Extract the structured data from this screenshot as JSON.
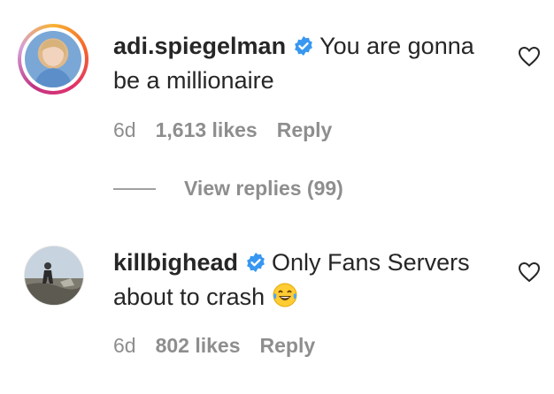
{
  "comments": [
    {
      "username": "adi.spiegelman",
      "verified": true,
      "text": "You are gonna be a millionaire",
      "time": "6d",
      "likes": "1,613 likes",
      "reply_label": "Reply",
      "view_replies": "View replies (99)",
      "avatar_icon": "profile-photo-with-story-ring"
    },
    {
      "username": "killbighead",
      "verified": true,
      "text": "Only Fans Servers about to crash",
      "emoji": "😂",
      "time": "6d",
      "likes": "802 likes",
      "reply_label": "Reply",
      "avatar_icon": "profile-photo"
    }
  ],
  "colors": {
    "text": "#262626",
    "secondary": "#8e8e8e",
    "verified": "#3897f0"
  }
}
